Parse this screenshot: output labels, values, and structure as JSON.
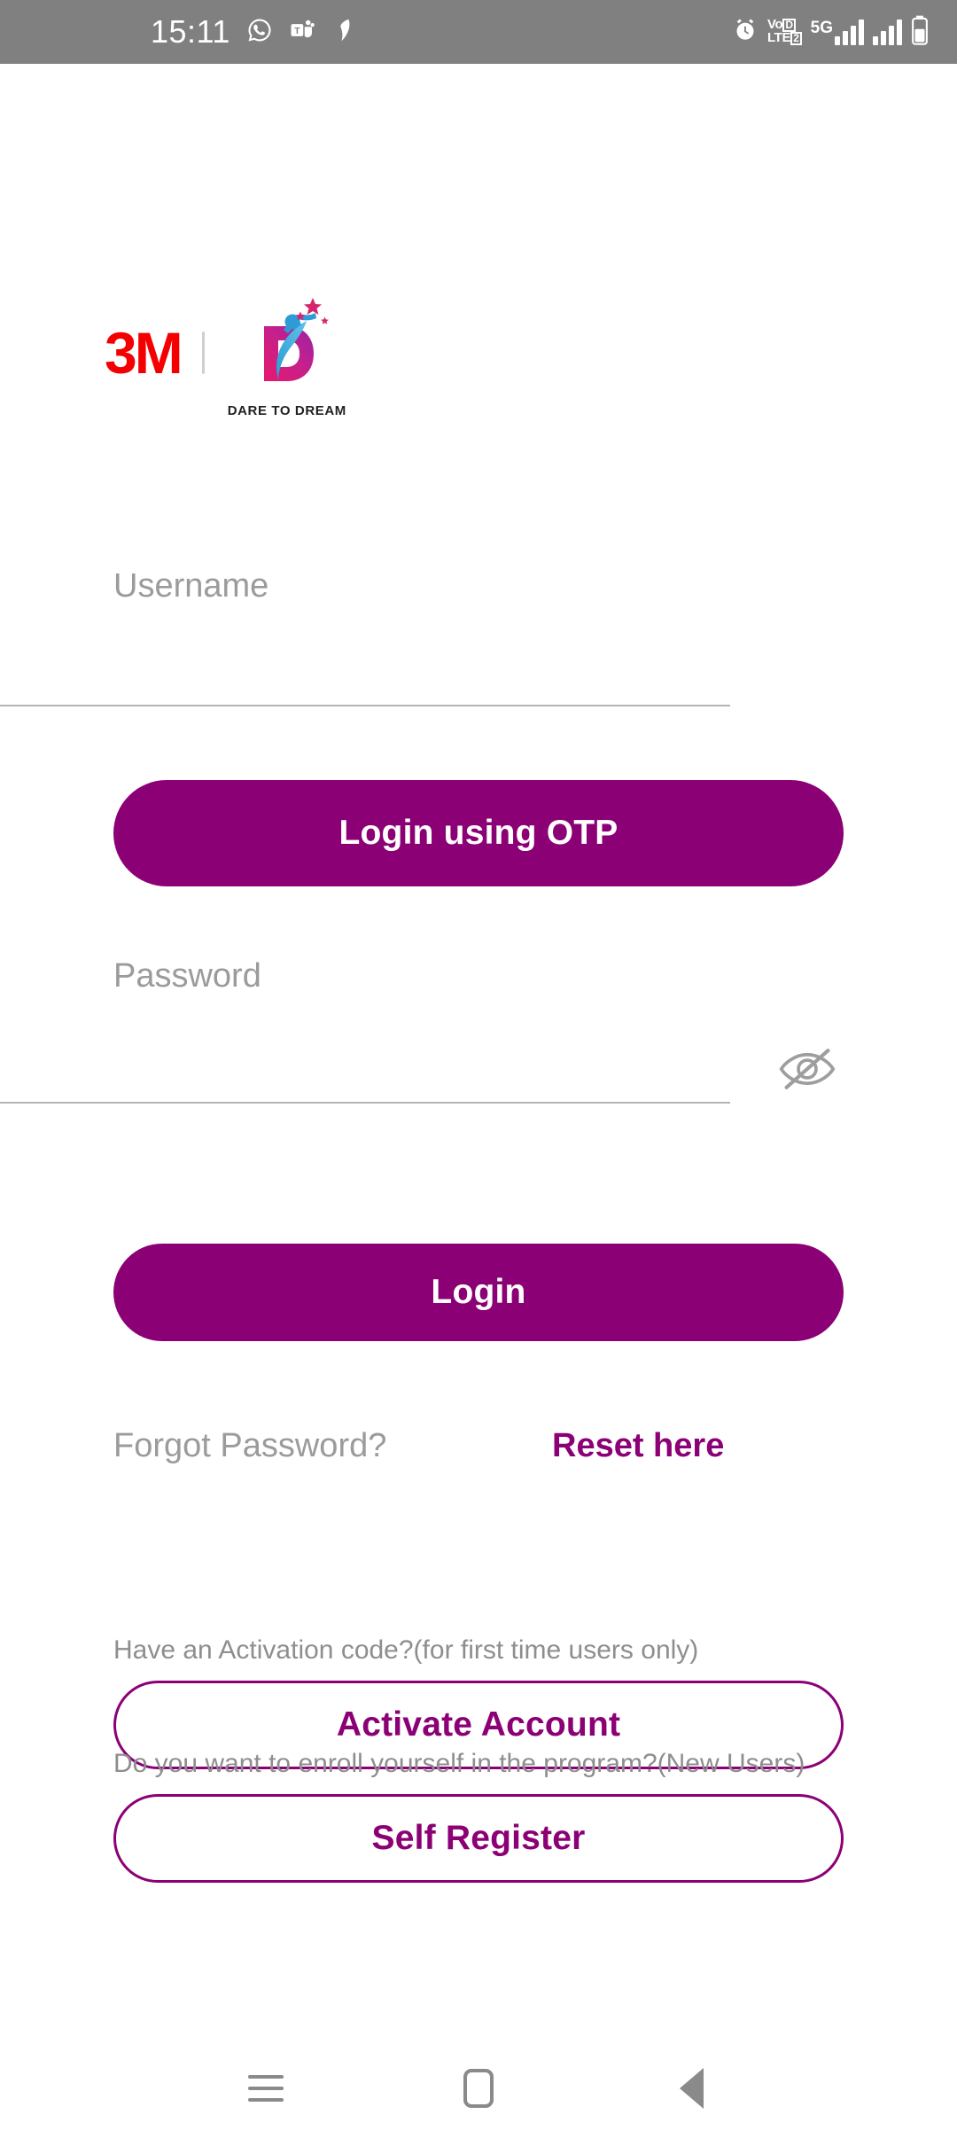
{
  "status_bar": {
    "time": "15:11",
    "left_icons": [
      "whatsapp-icon",
      "microsoft-teams-icon",
      "outlook-icon"
    ],
    "right_icons": [
      "alarm-icon",
      "volte-icon",
      "5g-signal-icon",
      "signal-bars-icon",
      "battery-icon"
    ],
    "volte_line1": "Vo",
    "volte_line2": "LTE",
    "volte_badge1": "D",
    "volte_badge2": "2",
    "network_label": "5G",
    "background_color": "#808080"
  },
  "brand": {
    "company_logo_text": "3M",
    "company_logo_color": "#F40000",
    "program_logo_letter": "D",
    "program_tagline": "DARE TO DREAM",
    "accent_color": "#8C0076"
  },
  "form": {
    "username": {
      "label": "Username",
      "value": "",
      "placeholder": ""
    },
    "password": {
      "label": "Password",
      "value": "",
      "placeholder": "",
      "visibility_icon": "eye-off-icon",
      "masked": true
    }
  },
  "actions": {
    "login_otp_label": "Login using OTP",
    "login_label": "Login",
    "activate_label": "Activate Account",
    "self_register_label": "Self Register"
  },
  "links": {
    "forgot_password_label": "Forgot Password?",
    "reset_link_label": "Reset here"
  },
  "helpers": {
    "activation_text": "Have an Activation code?(for first time users only)",
    "enroll_text": "Do you want to enroll yourself in the program?(New Users)"
  },
  "nav_bar": {
    "recents_icon": "recents-icon",
    "home_icon": "home-icon",
    "back_icon": "back-icon"
  }
}
